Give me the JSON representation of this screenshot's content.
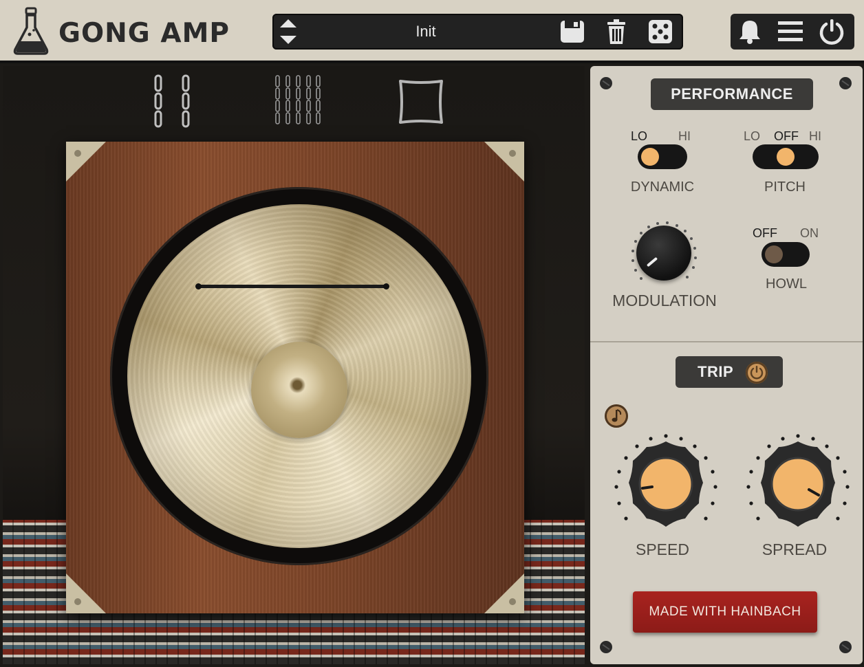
{
  "header": {
    "app_title": "GONG AMP",
    "preset_name": "Init",
    "icons": [
      "flask-logo-icon",
      "up-down-arrows-icon",
      "save-icon",
      "trash-icon",
      "dice-icon",
      "bell-icon",
      "menu-icon",
      "power-icon"
    ]
  },
  "scene": {
    "mic_options": [
      "double-chain-icon",
      "five-chain-icon",
      "square-frame-icon"
    ]
  },
  "panel": {
    "performance_label": "PERFORMANCE",
    "dynamic": {
      "lo": "LO",
      "hi": "HI",
      "label": "DYNAMIC",
      "value": "LO"
    },
    "pitch": {
      "lo": "LO",
      "off": "OFF",
      "hi": "HI",
      "label": "PITCH",
      "value": "OFF"
    },
    "modulation": {
      "label": "MODULATION"
    },
    "howl": {
      "off": "OFF",
      "on": "ON",
      "label": "HOWL",
      "value": "OFF"
    },
    "trip_label": "TRIP",
    "speed": {
      "label": "SPEED"
    },
    "spread": {
      "label": "SPREAD"
    },
    "made_with": "MADE WITH HAINBACH"
  },
  "colors": {
    "accent_orange": "#f2b56b",
    "panel_bg": "#d4cfc4",
    "header_bg": "#d8d2c4",
    "made_button_red": "#a8231f"
  }
}
